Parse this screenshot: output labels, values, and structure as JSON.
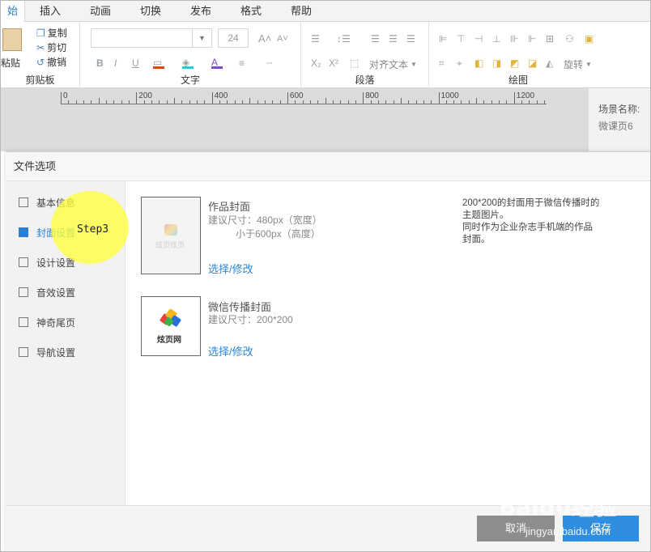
{
  "ribbon": {
    "tabs": [
      {
        "label": "始",
        "active": true
      },
      {
        "label": "插入"
      },
      {
        "label": "动画"
      },
      {
        "label": "切换"
      },
      {
        "label": "发布"
      },
      {
        "label": "格式"
      },
      {
        "label": "帮助"
      }
    ],
    "clipboard": {
      "paste": "粘贴",
      "copy": "复制",
      "cut": "剪切",
      "undo": "撤销",
      "label": "剪贴板"
    },
    "text": {
      "font_size": "24",
      "label": "文字"
    },
    "paragraph": {
      "align_text": "对齐文本",
      "label": "段落"
    },
    "drawing": {
      "rotate": "旋转",
      "label": "绘图"
    }
  },
  "ruler": {
    "labels": [
      "0",
      "200",
      "400",
      "600",
      "800",
      "1000",
      "1200"
    ]
  },
  "scene": {
    "name_label": "场景名称:",
    "name_value": "微课页6"
  },
  "dialog": {
    "title": "文件选项",
    "nav": [
      {
        "label": "基本信息"
      },
      {
        "label": "封面设置",
        "active": true
      },
      {
        "label": "设计设置"
      },
      {
        "label": "音效设置"
      },
      {
        "label": "神奇尾页"
      },
      {
        "label": "导航设置"
      }
    ],
    "step_label": "Step3",
    "cover": {
      "title": "作品封面",
      "hint1": "建议尺寸：480px（宽度）",
      "hint2": "小于600px（高度）",
      "link": "选择/修改",
      "thumb_text": "炫页炫页"
    },
    "wechat": {
      "title": "微信传播封面",
      "hint": "建议尺寸：200*200",
      "link": "选择/修改",
      "thumb_text": "炫页网"
    },
    "description": "200*200的封面用于微信传播时的主题图片。\n同时作为企业杂志手机端的作品封面。",
    "cancel": "取消",
    "save": "保存"
  },
  "watermark": {
    "brand": "Baidu经验",
    "site": "jingyan.baidu.com"
  },
  "colors": {
    "accent": "#2a7fd4",
    "highlight": "#ffff3c",
    "save": "#2f8ee0",
    "cancel": "#8d8d8d"
  }
}
